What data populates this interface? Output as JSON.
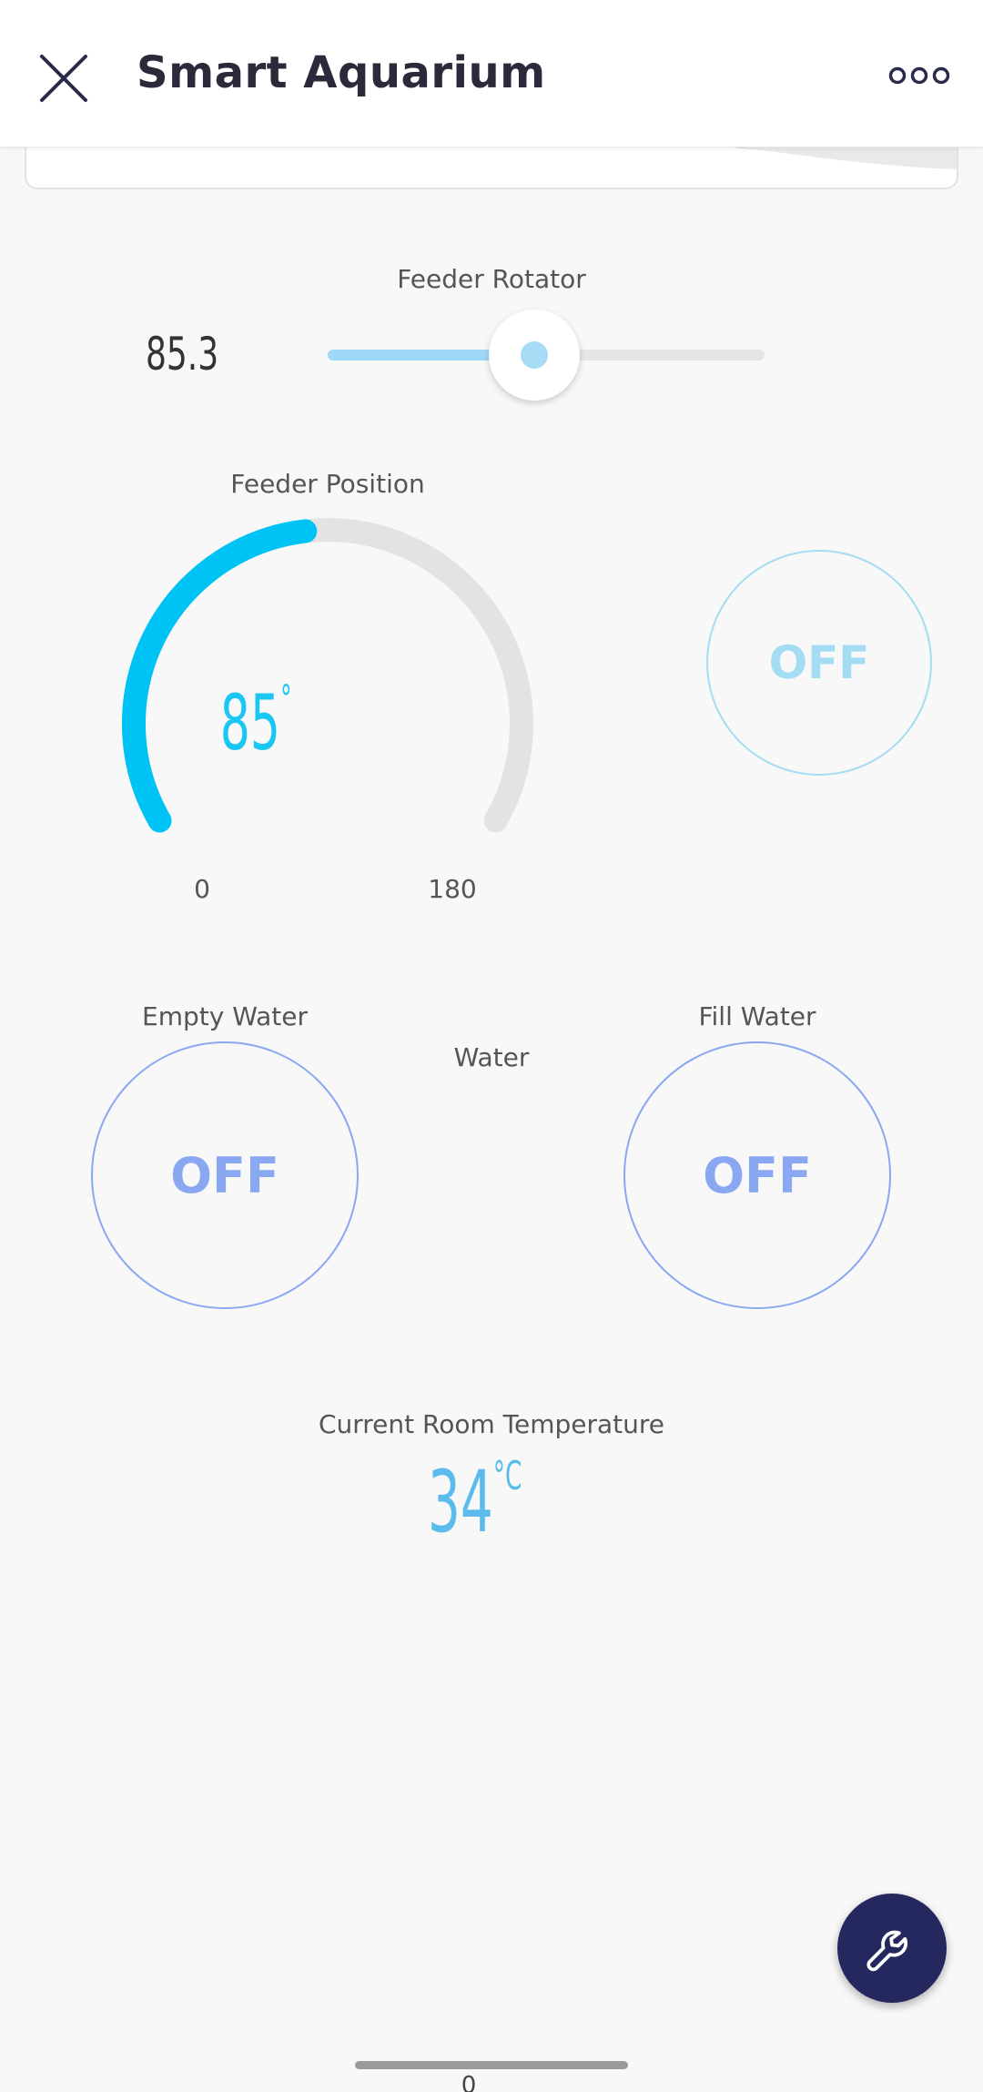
{
  "app": {
    "title": "Smart Aquarium"
  },
  "icons": {
    "close": "close-icon",
    "more": "more-options-icon",
    "settings": "wrench-icon"
  },
  "feeder_rotator": {
    "label": "Feeder Rotator",
    "value": "85.3",
    "fraction": 0.47
  },
  "feeder_position": {
    "label": "Feeder Position",
    "value": "85",
    "unit": "°",
    "min": "0",
    "max": "180",
    "numeric_value": 85,
    "numeric_min": 0,
    "numeric_max": 180,
    "toggle": "OFF"
  },
  "water": {
    "label": "Water",
    "empty": {
      "label": "Empty Water",
      "state": "OFF"
    },
    "fill": {
      "label": "Fill Water",
      "state": "OFF"
    }
  },
  "room_temperature": {
    "label": "Current Room Temperature",
    "value": "34",
    "unit": "°C"
  },
  "bottom": {
    "page_indicator": "0"
  },
  "colors": {
    "gauge_active": "#00c3f5",
    "gauge_track": "#e3e3e3",
    "slider_fill": "#9fd9f7",
    "toggle_light_blue": "#a3dcf3",
    "toggle_periwinkle": "#8aa7f2",
    "temperature": "#5bbcec",
    "fab": "#24285e"
  }
}
